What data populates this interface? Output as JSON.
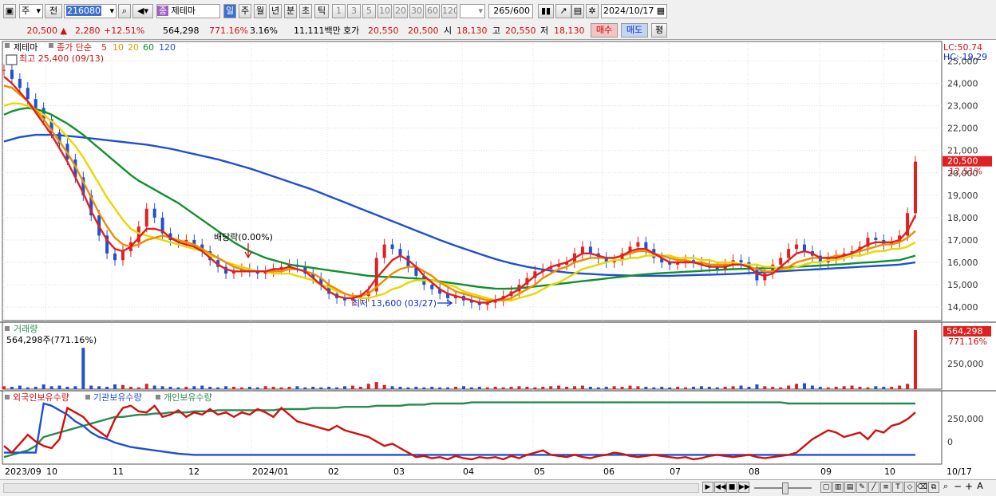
{
  "toolbar": {
    "period_unit": "주",
    "prev_label": "전",
    "stock_code": "216080",
    "theme_badge": "종",
    "stock_name": "제테마",
    "periods": [
      "일",
      "주",
      "월",
      "년",
      "분",
      "초",
      "틱"
    ],
    "intervals": [
      "1",
      "3",
      "5",
      "10",
      "20",
      "30",
      "60",
      "120"
    ],
    "bar_count": "265",
    "bar_total": "/600",
    "date": "2024/10/17"
  },
  "quote": {
    "price": "20,500",
    "change": "2,280",
    "change_pct": "+12.51%",
    "volume": "564,298",
    "volume_pct": "771.16%",
    "turnover": "3.16%",
    "amount": "11,111백만",
    "ask_label": "호가",
    "ask": "20,550",
    "bid": "20,500",
    "open_label": "시",
    "open": "18,130",
    "high_label": "고",
    "high": "20,550",
    "low_label": "저",
    "low": "18,130",
    "buy_label": "매수",
    "sell_label": "매도",
    "eval_label": "평"
  },
  "legend": {
    "name": "제테마",
    "series_label": "종가 단순",
    "ma": [
      "5",
      "10",
      "20",
      "60",
      "120"
    ],
    "ma_colors": [
      "#e02020",
      "#f08c00",
      "#e8d800",
      "#109030",
      "#2050d0"
    ],
    "high_note": "최고 25,400 (09/13)",
    "lc": "LC:50.74",
    "hc": "HC:-19.29"
  },
  "annotations": {
    "dividend": "배당락(0.00%)",
    "low_note": "최저 13,600 (03/27)"
  },
  "volume_panel": {
    "title": "거래량",
    "value_text": "564,298주(771.16%)",
    "last_value": "564,298",
    "last_pct": "771.16%",
    "tick": "250,000"
  },
  "holdings_panel": {
    "titles": [
      "외국인보유수량",
      "기관보유수량",
      "개인보유수량"
    ],
    "colors": [
      "#d01010",
      "#2050d0",
      "#2a8a50"
    ],
    "ticks": [
      "250,000",
      "0"
    ]
  },
  "chart_data": {
    "type": "line",
    "price_axis": {
      "ylim": [
        13400,
        25800
      ],
      "ticks": [
        14000,
        15000,
        16000,
        17000,
        18000,
        19000,
        20000,
        21000,
        22000,
        23000,
        24000,
        25000
      ]
    },
    "price_tick_labels": [
      "14,000",
      "15,000",
      "16,000",
      "17,000",
      "18,000",
      "19,000",
      "20,000",
      "21,000",
      "22,000",
      "23,000",
      "24,000",
      "25,000"
    ],
    "last_price_label": "20,500",
    "last_change_label": "12.51%",
    "x_labels": [
      "2023/09",
      "10",
      "11",
      "12",
      "2024/01",
      "02",
      "03",
      "04",
      "05",
      "06",
      "07",
      "08",
      "09",
      "10",
      "10/17"
    ],
    "close": [
      24600,
      24200,
      23800,
      23300,
      22900,
      22400,
      21800,
      21300,
      20600,
      19800,
      19000,
      18100,
      17200,
      16400,
      16100,
      16500,
      16900,
      17600,
      18400,
      18000,
      17300,
      17000,
      16900,
      17000,
      16800,
      16500,
      16100,
      15800,
      15500,
      15600,
      15700,
      15600,
      15500,
      15600,
      15700,
      15800,
      15900,
      15800,
      15500,
      15300,
      15000,
      14600,
      14400,
      14300,
      14400,
      14500,
      14700,
      16200,
      16800,
      16600,
      16300,
      15800,
      15400,
      15000,
      14800,
      14600,
      14400,
      14500,
      14300,
      14200,
      14100,
      14200,
      14300,
      14500,
      14700,
      15000,
      15300,
      15600,
      15700,
      15800,
      15900,
      16000,
      16400,
      16700,
      16400,
      16200,
      16000,
      16100,
      16400,
      16700,
      16900,
      16600,
      16200,
      16000,
      15900,
      16000,
      16100,
      16000,
      15900,
      15800,
      15700,
      15900,
      16100,
      16000,
      15700,
      15200,
      15500,
      15900,
      16200,
      16600,
      16800,
      16500,
      16300,
      16000,
      16200,
      16300,
      16400,
      16500,
      16700,
      17100,
      17000,
      16800,
      16900,
      17200,
      18200,
      20500
    ],
    "ma5": [
      24300,
      24000,
      23600,
      23200,
      22700,
      22200,
      21700,
      21100,
      20500,
      19800,
      19100,
      18300,
      17600,
      17000,
      16600,
      16500,
      16700,
      17100,
      17500,
      17500,
      17400,
      17100,
      16900,
      16800,
      16700,
      16500,
      16200,
      15900,
      15700,
      15600,
      15600,
      15600,
      15600,
      15600,
      15700,
      15700,
      15800,
      15700,
      15600,
      15300,
      15000,
      14700,
      14500,
      14400,
      14400,
      14500,
      14800,
      15300,
      15700,
      16100,
      16300,
      16100,
      15800,
      15400,
      15100,
      14800,
      14600,
      14500,
      14400,
      14300,
      14200,
      14200,
      14300,
      14400,
      14600,
      14800,
      15100,
      15400,
      15600,
      15800,
      15900,
      16000,
      16200,
      16400,
      16400,
      16300,
      16200,
      16200,
      16300,
      16500,
      16600,
      16600,
      16400,
      16200,
      16000,
      16000,
      16000,
      16000,
      15900,
      15800,
      15800,
      15800,
      15900,
      15900,
      15800,
      15500,
      15400,
      15500,
      15800,
      16100,
      16400,
      16500,
      16400,
      16200,
      16200,
      16200,
      16300,
      16400,
      16600,
      16800,
      16900,
      16900,
      16900,
      17000,
      17400,
      18100
    ],
    "ma10": [
      23900,
      23800,
      23500,
      23200,
      22800,
      22400,
      21900,
      21400,
      20900,
      20300,
      19600,
      18900,
      18200,
      17600,
      17100,
      16800,
      16700,
      16800,
      17000,
      17100,
      17200,
      17100,
      17000,
      16900,
      16800,
      16600,
      16400,
      16200,
      16000,
      15800,
      15700,
      15600,
      15600,
      15600,
      15600,
      15600,
      15700,
      15700,
      15600,
      15500,
      15300,
      15000,
      14800,
      14600,
      14500,
      14500,
      14600,
      14900,
      15200,
      15500,
      15700,
      15800,
      15800,
      15600,
      15400,
      15100,
      14900,
      14700,
      14600,
      14500,
      14400,
      14300,
      14300,
      14300,
      14400,
      14600,
      14800,
      15000,
      15300,
      15500,
      15700,
      15800,
      16000,
      16100,
      16200,
      16200,
      16200,
      16200,
      16300,
      16400,
      16500,
      16500,
      16400,
      16300,
      16200,
      16100,
      16100,
      16000,
      16000,
      15900,
      15900,
      15900,
      15900,
      15900,
      15800,
      15700,
      15600,
      15600,
      15700,
      15800,
      16000,
      16100,
      16200,
      16200,
      16200,
      16300,
      16300,
      16400,
      16500,
      16600,
      16700,
      16800,
      16800,
      16900,
      17100,
      17400
    ],
    "ma20": [
      23000,
      23100,
      23100,
      23000,
      22800,
      22600,
      22300,
      22000,
      21600,
      21200,
      20700,
      20100,
      19500,
      18900,
      18400,
      17900,
      17500,
      17300,
      17200,
      17100,
      17000,
      16900,
      16800,
      16700,
      16600,
      16500,
      16300,
      16200,
      16000,
      15900,
      15800,
      15700,
      15600,
      15600,
      15500,
      15500,
      15500,
      15400,
      15300,
      15200,
      15000,
      14900,
      14700,
      14600,
      14500,
      14400,
      14400,
      14500,
      14600,
      14800,
      14900,
      15100,
      15200,
      15200,
      15200,
      15100,
      15000,
      14900,
      14700,
      14600,
      14500,
      14400,
      14300,
      14300,
      14300,
      14400,
      14500,
      14600,
      14800,
      15000,
      15100,
      15300,
      15500,
      15700,
      15800,
      15900,
      16000,
      16100,
      16100,
      16200,
      16200,
      16300,
      16300,
      16300,
      16300,
      16200,
      16200,
      16200,
      16100,
      16100,
      16000,
      16000,
      16000,
      15900,
      15900,
      15900,
      15800,
      15800,
      15700,
      15700,
      15800,
      15900,
      16000,
      16000,
      16100,
      16100,
      16200,
      16300,
      16300,
      16400,
      16500,
      16500,
      16600,
      16600,
      16700,
      16900
    ],
    "ma60": [
      22600,
      22750,
      22850,
      22900,
      22850,
      22750,
      22600,
      22400,
      22200,
      21950,
      21700,
      21400,
      21100,
      20800,
      20500,
      20200,
      19900,
      19650,
      19450,
      19250,
      19050,
      18850,
      18650,
      18400,
      18150,
      17900,
      17650,
      17400,
      17150,
      16900,
      16700,
      16500,
      16350,
      16200,
      16100,
      16000,
      15900,
      15850,
      15800,
      15750,
      15700,
      15650,
      15600,
      15550,
      15500,
      15450,
      15400,
      15380,
      15350,
      15350,
      15330,
      15300,
      15280,
      15250,
      15200,
      15150,
      15100,
      15050,
      15000,
      14950,
      14900,
      14860,
      14830,
      14820,
      14830,
      14850,
      14880,
      14920,
      14960,
      15000,
      15040,
      15080,
      15120,
      15160,
      15200,
      15240,
      15280,
      15320,
      15360,
      15400,
      15440,
      15470,
      15500,
      15520,
      15540,
      15560,
      15580,
      15600,
      15620,
      15640,
      15660,
      15680,
      15700,
      15710,
      15720,
      15730,
      15740,
      15750,
      15760,
      15780,
      15800,
      15820,
      15840,
      15860,
      15880,
      15900,
      15920,
      15950,
      15980,
      16000,
      16020,
      16050,
      16080,
      16100,
      16200,
      16300
    ],
    "ma120": [
      21400,
      21500,
      21600,
      21650,
      21700,
      21700,
      21700,
      21680,
      21650,
      21620,
      21580,
      21540,
      21500,
      21460,
      21420,
      21380,
      21340,
      21300,
      21260,
      21200,
      21140,
      21080,
      21000,
      20920,
      20840,
      20760,
      20680,
      20600,
      20500,
      20400,
      20300,
      20200,
      20080,
      19960,
      19840,
      19720,
      19600,
      19480,
      19360,
      19240,
      19100,
      18960,
      18820,
      18680,
      18540,
      18400,
      18260,
      18120,
      17980,
      17840,
      17700,
      17560,
      17420,
      17280,
      17140,
      17000,
      16870,
      16740,
      16620,
      16500,
      16380,
      16260,
      16150,
      16050,
      15960,
      15880,
      15800,
      15740,
      15680,
      15630,
      15590,
      15550,
      15520,
      15500,
      15480,
      15460,
      15440,
      15430,
      15420,
      15410,
      15400,
      15400,
      15400,
      15400,
      15400,
      15410,
      15420,
      15430,
      15440,
      15450,
      15460,
      15470,
      15480,
      15500,
      15520,
      15540,
      15560,
      15580,
      15600,
      15620,
      15640,
      15660,
      15680,
      15700,
      15720,
      15740,
      15760,
      15780,
      15800,
      15820,
      15840,
      15860,
      15880,
      15900,
      15950,
      16000
    ],
    "volume_pct": [
      5,
      4,
      6,
      3,
      4,
      8,
      5,
      6,
      4,
      5,
      70,
      6,
      5,
      4,
      8,
      7,
      4,
      3,
      9,
      6,
      5,
      4,
      3,
      4,
      5,
      6,
      4,
      3,
      5,
      4,
      3,
      4,
      3,
      5,
      4,
      3,
      4,
      5,
      3,
      4,
      3,
      4,
      3,
      5,
      6,
      4,
      9,
      12,
      7,
      5,
      4,
      3,
      4,
      3,
      4,
      3,
      3,
      4,
      5,
      3,
      4,
      3,
      4,
      3,
      4,
      5,
      4,
      3,
      4,
      5,
      6,
      4,
      5,
      6,
      4,
      3,
      4,
      5,
      4,
      6,
      5,
      4,
      3,
      4,
      3,
      4,
      3,
      4,
      5,
      4,
      3,
      4,
      5,
      6,
      4,
      8,
      5,
      4,
      3,
      6,
      9,
      10,
      6,
      4,
      3,
      4,
      5,
      6,
      4,
      3,
      5,
      4,
      4,
      6,
      9,
      100
    ],
    "foreign": [
      120,
      60,
      140,
      220,
      160,
      120,
      100,
      180,
      460,
      420,
      380,
      300,
      250,
      200,
      360,
      460,
      480,
      430,
      420,
      480,
      380,
      400,
      440,
      380,
      420,
      400,
      450,
      400,
      420,
      380,
      420,
      400,
      450,
      420,
      380,
      460,
      400,
      340,
      320,
      300,
      280,
      260,
      300,
      260,
      240,
      220,
      200,
      160,
      120,
      140,
      100,
      60,
      20,
      30,
      10,
      20,
      0,
      30,
      10,
      0,
      20,
      10,
      20,
      0,
      30,
      10,
      40,
      60,
      80,
      40,
      30,
      20,
      40,
      20,
      10,
      30,
      40,
      60,
      50,
      30,
      20,
      30,
      40,
      30,
      20,
      10,
      20,
      0,
      10,
      30,
      40,
      30,
      20,
      30,
      40,
      20,
      10,
      20,
      30,
      40,
      60,
      120,
      180,
      220,
      260,
      240,
      200,
      220,
      240,
      180,
      260,
      240,
      300,
      320,
      360,
      420
    ],
    "institution": [
      60,
      60,
      60,
      60,
      60,
      500,
      480,
      440,
      400,
      340,
      300,
      240,
      200,
      180,
      150,
      130,
      110,
      100,
      90,
      80,
      70,
      60,
      50,
      45,
      40,
      40,
      40,
      40,
      40,
      40,
      40,
      40,
      40,
      40,
      40,
      40,
      40,
      40,
      40,
      40,
      40,
      40,
      40,
      40,
      40,
      40,
      40,
      40,
      40,
      40,
      40,
      40,
      40,
      40,
      40,
      40,
      40,
      40,
      40,
      40,
      40,
      40,
      40,
      40,
      40,
      40,
      40,
      40,
      40,
      40,
      40,
      40,
      40,
      40,
      40,
      40,
      40,
      40,
      40,
      40,
      40,
      40,
      40,
      40,
      40,
      40,
      40,
      40,
      40,
      40,
      40,
      40,
      40,
      40,
      40,
      40,
      40,
      40,
      40,
      40,
      40,
      40,
      40,
      40,
      40,
      40,
      40,
      40,
      40,
      40,
      40,
      40,
      40,
      40,
      40,
      40
    ],
    "individual": [
      20,
      40,
      60,
      80,
      120,
      200,
      220,
      240,
      260,
      280,
      300,
      320,
      340,
      360,
      380,
      380,
      390,
      400,
      400,
      410,
      410,
      420,
      420,
      420,
      430,
      430,
      430,
      440,
      440,
      440,
      440,
      440,
      440,
      440,
      440,
      450,
      450,
      450,
      450,
      460,
      460,
      460,
      460,
      470,
      470,
      470,
      470,
      480,
      480,
      480,
      480,
      490,
      490,
      490,
      500,
      500,
      500,
      500,
      500,
      510,
      510,
      510,
      510,
      510,
      510,
      510,
      510,
      510,
      510,
      510,
      510,
      510,
      510,
      510,
      510,
      510,
      510,
      510,
      510,
      510,
      510,
      510,
      510,
      510,
      510,
      510,
      510,
      510,
      510,
      510,
      510,
      510,
      510,
      510,
      510,
      510,
      510,
      510,
      510,
      500,
      500,
      500,
      500,
      500,
      500,
      500,
      500,
      500,
      500,
      500,
      500,
      500,
      500,
      500,
      500,
      500
    ]
  }
}
